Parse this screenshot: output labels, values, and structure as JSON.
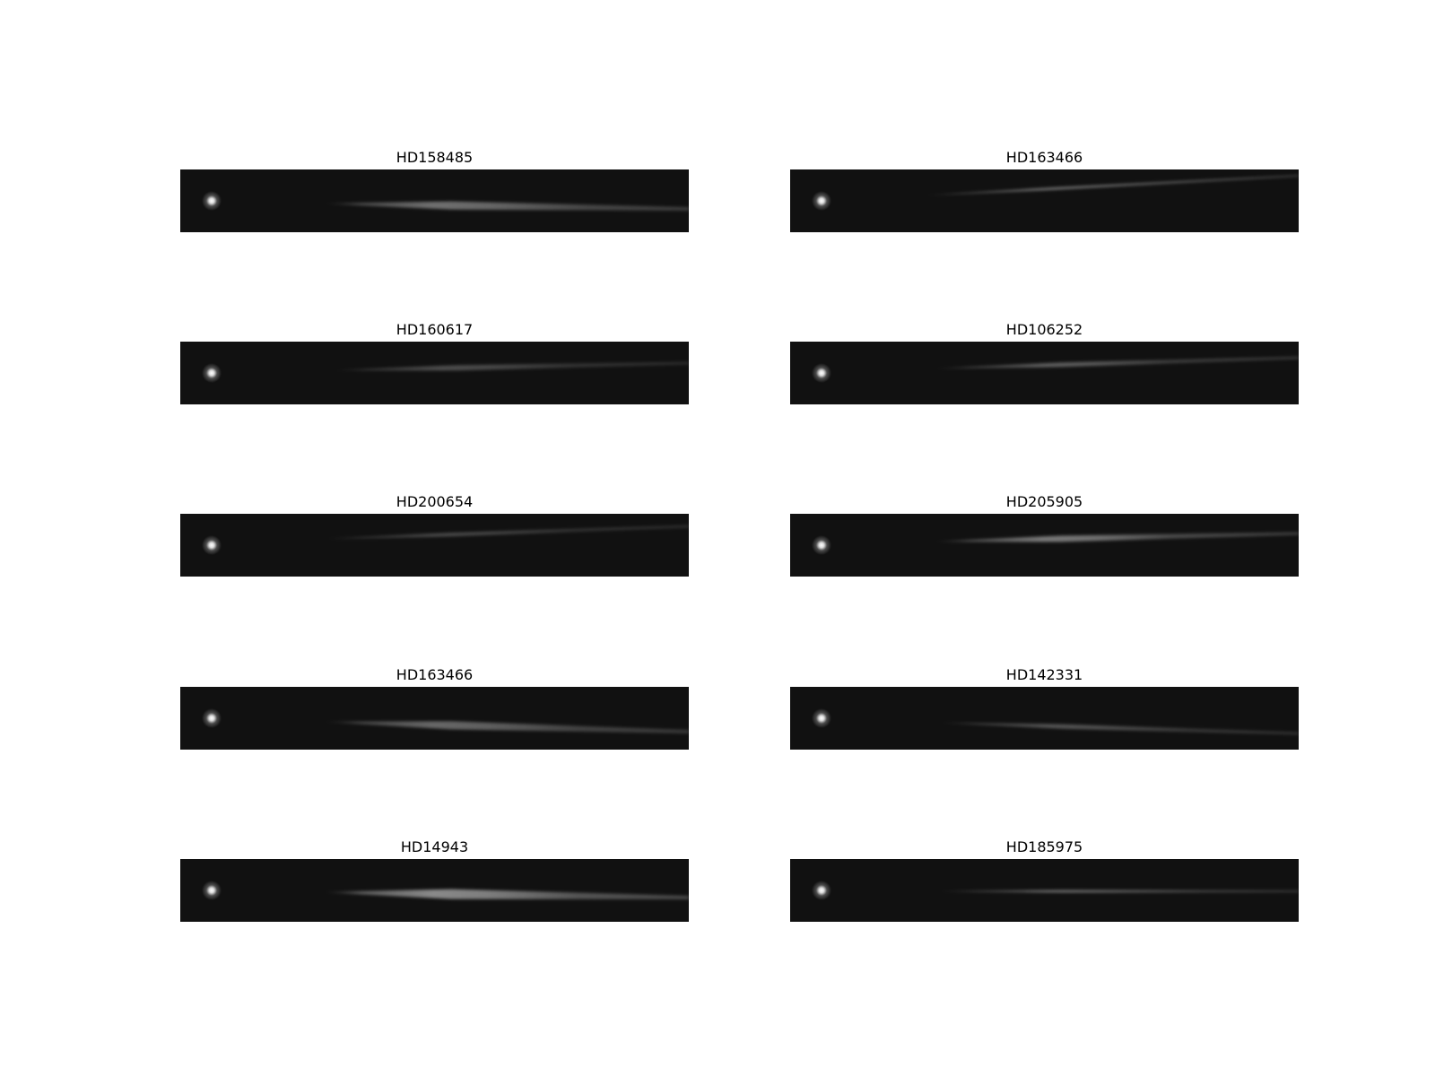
{
  "figure": {
    "panels": [
      {
        "title": "HD158485"
      },
      {
        "title": "HD163466"
      },
      {
        "title": "HD160617"
      },
      {
        "title": "HD106252"
      },
      {
        "title": "HD200654"
      },
      {
        "title": "HD205905"
      },
      {
        "title": "HD163466"
      },
      {
        "title": "HD142331"
      },
      {
        "title": "HD14943"
      },
      {
        "title": "HD185975"
      }
    ]
  },
  "colors": {
    "background": "#111111",
    "star": "#ffffff",
    "streak": "#bdbdbd"
  }
}
